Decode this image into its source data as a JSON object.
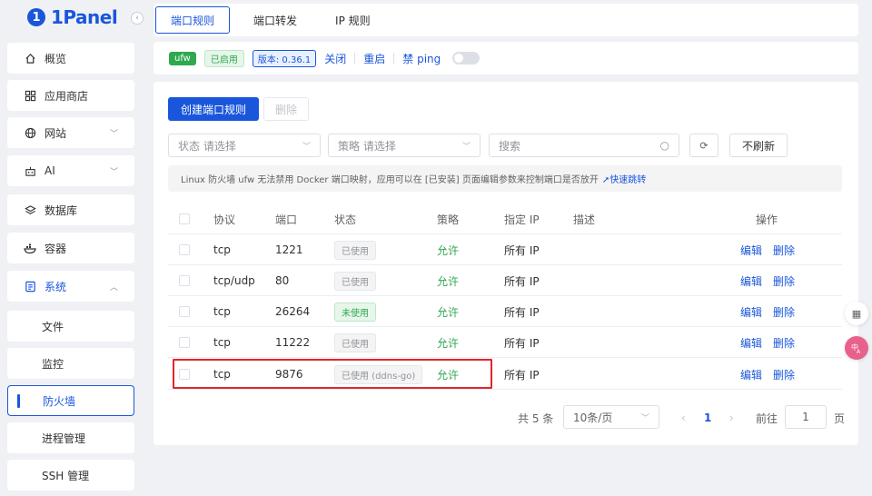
{
  "app": {
    "logo_mark": "1",
    "logo_text": "1Panel"
  },
  "sidebar": {
    "items": [
      {
        "label": "概览",
        "icon": "home-icon"
      },
      {
        "label": "应用商店",
        "icon": "grid-icon"
      },
      {
        "label": "网站",
        "icon": "globe-icon"
      },
      {
        "label": "AI",
        "icon": "robot-icon"
      },
      {
        "label": "数据库",
        "icon": "database-icon"
      },
      {
        "label": "容器",
        "icon": "docker-icon"
      },
      {
        "label": "系统",
        "icon": "system-icon"
      }
    ],
    "sub_items": [
      "文件",
      "监控",
      "防火墙",
      "进程管理",
      "SSH 管理"
    ]
  },
  "tabs": [
    "端口规则",
    "端口转发",
    "IP 规则"
  ],
  "status": {
    "engine": "ufw",
    "state": "已启用",
    "version": "版本: 0.36.1",
    "close": "关闭",
    "restart": "重启",
    "ping_label": "禁 ping"
  },
  "toolbar": {
    "create": "创建端口规则",
    "delete": "删除",
    "status_filter": "状态 请选择",
    "strategy_filter": "策略 请选择",
    "search_placeholder": "搜索",
    "no_refresh": "不刷新"
  },
  "notice": {
    "text": "Linux 防火墙 ufw 无法禁用 Docker 端口映射，应用可以在 [已安装] 页面编辑参数来控制端口是否放开",
    "link": "快速跳转"
  },
  "table": {
    "headers": [
      "协议",
      "端口",
      "状态",
      "策略",
      "指定 IP",
      "描述",
      "操作"
    ],
    "rows": [
      {
        "protocol": "tcp",
        "port": "1221",
        "status": "已使用",
        "used": true,
        "strategy": "允许",
        "ip": "所有 IP",
        "desc": ""
      },
      {
        "protocol": "tcp/udp",
        "port": "80",
        "status": "已使用",
        "used": true,
        "strategy": "允许",
        "ip": "所有 IP",
        "desc": ""
      },
      {
        "protocol": "tcp",
        "port": "26264",
        "status": "未使用",
        "used": false,
        "strategy": "允许",
        "ip": "所有 IP",
        "desc": ""
      },
      {
        "protocol": "tcp",
        "port": "11222",
        "status": "已使用",
        "used": true,
        "strategy": "允许",
        "ip": "所有 IP",
        "desc": ""
      },
      {
        "protocol": "tcp",
        "port": "9876",
        "status": "已使用 (ddns-go)",
        "used": true,
        "strategy": "允许",
        "ip": "所有 IP",
        "desc": ""
      }
    ],
    "edit": "编辑",
    "remove": "删除"
  },
  "pagination": {
    "total": "共 5 条",
    "page_size": "10条/页",
    "current": "1",
    "goto_label": "前往",
    "goto_value": "1",
    "page_unit": "页"
  }
}
